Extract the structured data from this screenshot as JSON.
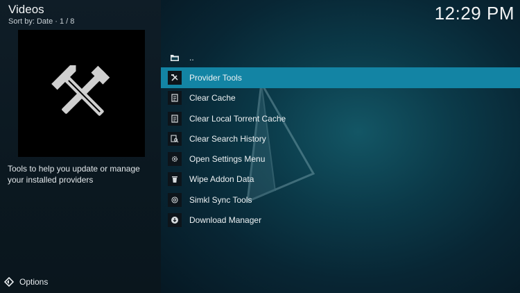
{
  "header": {
    "title": "Videos",
    "subtitle": "Sort by: Date  ·  1 / 8"
  },
  "clock": "12:29 PM",
  "thumbnail": {
    "icon": "hammer-wrench-icon"
  },
  "description": "Tools to help you update or manage your installed providers",
  "options_label": "Options",
  "list": {
    "items": [
      {
        "label": "..",
        "icon": "folder-up-icon"
      },
      {
        "label": "Provider Tools",
        "icon": "tools-icon"
      },
      {
        "label": "Clear Cache",
        "icon": "clear-icon"
      },
      {
        "label": "Clear Local Torrent Cache",
        "icon": "clear-icon"
      },
      {
        "label": "Clear Search History",
        "icon": "clear-search-icon"
      },
      {
        "label": "Open Settings Menu",
        "icon": "gear-icon"
      },
      {
        "label": "Wipe Addon Data",
        "icon": "trash-icon"
      },
      {
        "label": "Simkl Sync Tools",
        "icon": "sync-icon"
      },
      {
        "label": "Download Manager",
        "icon": "download-icon"
      }
    ],
    "selected_index": 1
  },
  "colors": {
    "selection": "#1384a4",
    "left_panel": "#0f1d27",
    "right_panel": "#0b3a49"
  }
}
